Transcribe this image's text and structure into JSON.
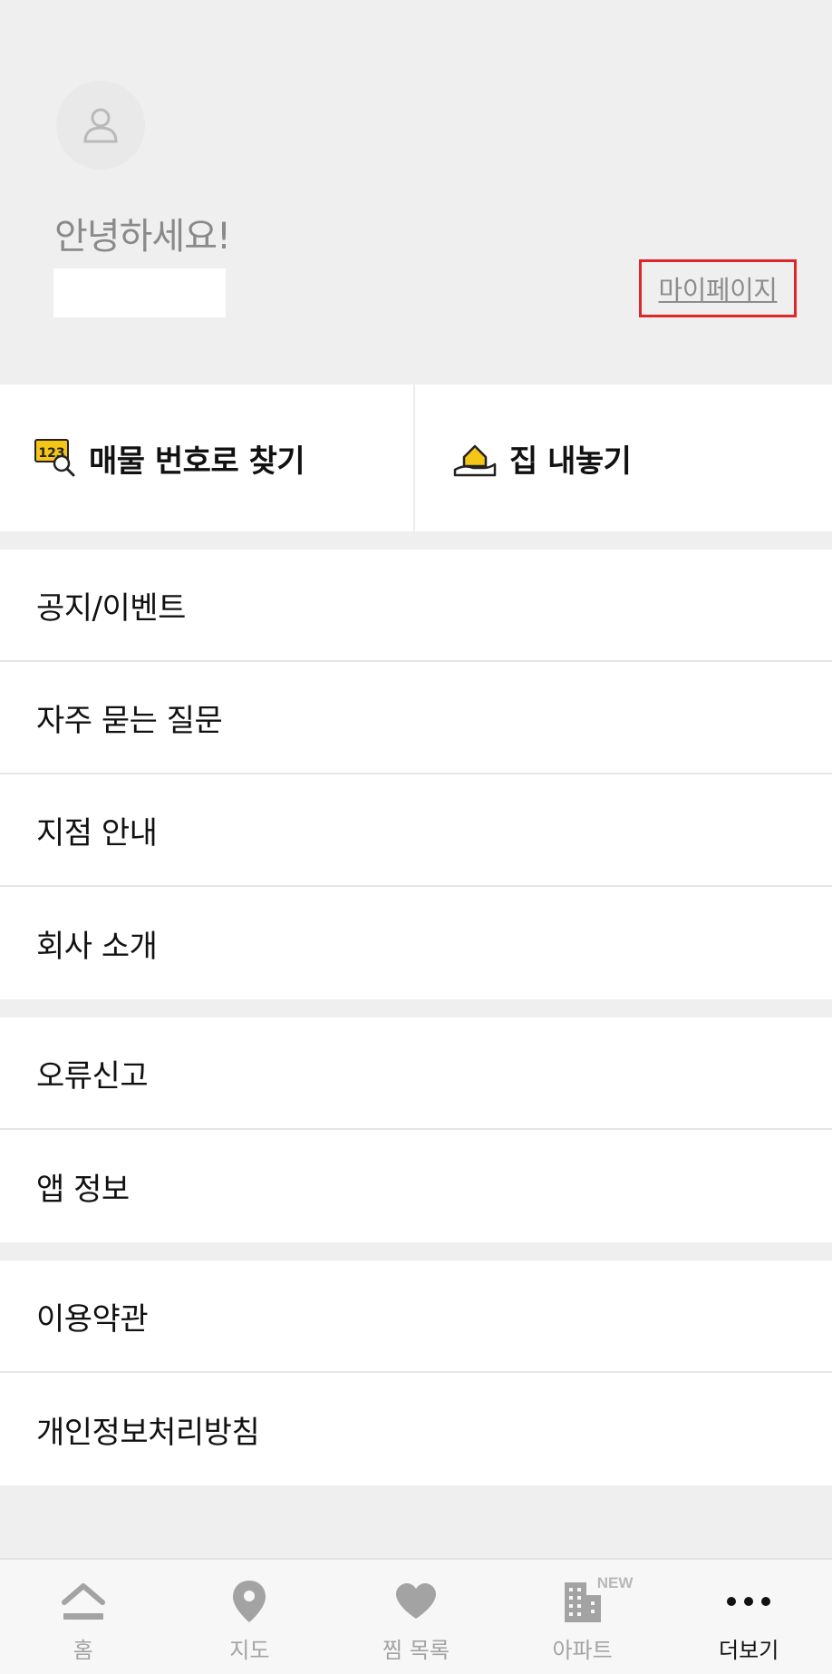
{
  "header": {
    "greeting": "안녕하세요!",
    "mypage_label": "마이페이지"
  },
  "quick_actions": {
    "find_by_number_label": "매물 번호로 찾기",
    "find_by_number_icon_text": "123",
    "list_house_label": "집 내놓기"
  },
  "menu_groups": [
    {
      "items": [
        "공지/이벤트",
        "자주 묻는 질문",
        "지점 안내",
        "회사 소개"
      ]
    },
    {
      "items": [
        "오류신고",
        "앱 정보"
      ]
    },
    {
      "items": [
        "이용약관",
        "개인정보처리방침"
      ]
    }
  ],
  "tabbar": {
    "tabs": [
      {
        "label": "홈",
        "icon": "home-icon"
      },
      {
        "label": "지도",
        "icon": "map-pin-icon"
      },
      {
        "label": "찜 목록",
        "icon": "heart-icon"
      },
      {
        "label": "아파트",
        "icon": "building-icon",
        "badge": "NEW"
      },
      {
        "label": "더보기",
        "icon": "more-dots-icon",
        "active": true
      }
    ]
  },
  "colors": {
    "background": "#efefef",
    "highlight_border": "#e0262b",
    "accent_yellow": "#f5c518",
    "inactive_tab": "#a3a3a3",
    "active_tab": "#111111"
  }
}
